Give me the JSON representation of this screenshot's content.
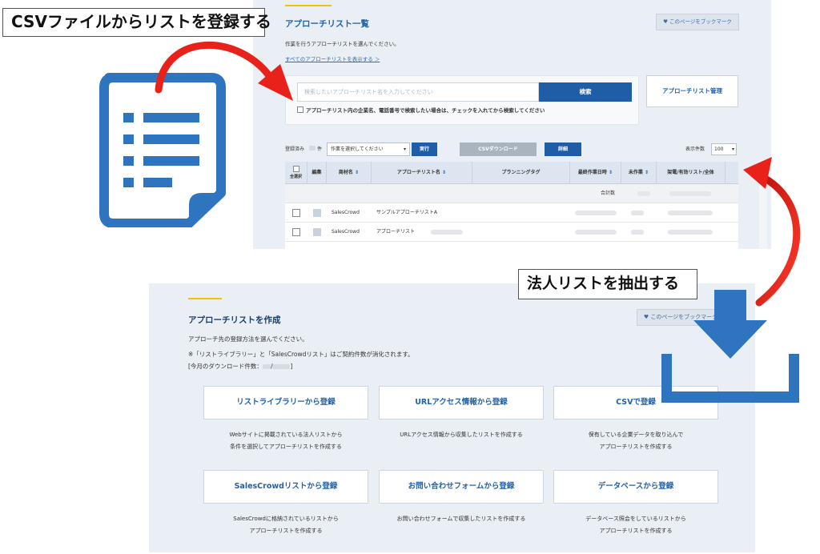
{
  "callouts": {
    "csv": "CSVファイルからリストを登録する",
    "extract": "法人リストを抽出する"
  },
  "list_page": {
    "title": "アプローチリスト一覧",
    "bookmark": "♥ このページをブックマーク",
    "subtitle": "作業を行うアプローチリストを選んでください。",
    "show_all_link": "すべてのアプローチリストを表示する ＞",
    "search_placeholder": "検索したいアプローチリスト名を入力してください",
    "search_button": "検索",
    "search_option": "アプローチリスト内の企業名、電話番号で検索したい場合は、チェックを入れてから検索してください",
    "manage_button": "アプローチリスト管理",
    "toolbar": {
      "registered_label": "登録済み",
      "count_unit": "件",
      "operation_select": "作業を選択してください",
      "exec_button": "実行",
      "csv_download": "CSVダウンロード",
      "detail_button": "詳細",
      "per_page_label": "表示件数",
      "per_page_value": "100"
    },
    "table": {
      "headers": {
        "select_all": "全選択",
        "edit": "編集",
        "company": "商材名",
        "list_name": "アプローチリスト名",
        "planning_tag": "プランニングタグ",
        "last_work_date": "最終作業日時",
        "unworked": "未作業",
        "valid_total": "架電/有効リスト/全体"
      },
      "total_label": "合計数",
      "rows": [
        {
          "company": "SalesCrowd",
          "list_name": "サンプルアプローチリストA"
        },
        {
          "company": "SalesCrowd",
          "list_name": "アプローチリスト"
        }
      ]
    }
  },
  "create_page": {
    "title": "アプローチリストを作成",
    "bookmark": "♥ このページをブックマーク",
    "lead": "アプローチ先の登録方法を選んでください。",
    "note": "※「リストライブラリー」と「SalesCrowdリスト」はご契約件数が消化されます。",
    "download_count_prefix": "[今月のダウンロード件数：",
    "download_count_sep": "/",
    "download_count_suffix": "]",
    "options": [
      {
        "label": "リストライブラリーから登録",
        "desc1": "Webサイトに掲載されている法人リストから",
        "desc2": "条件を選択してアプローチリストを作成する"
      },
      {
        "label": "URLアクセス情報から登録",
        "desc1": "URLアクセス情報から収集したリストを作成する",
        "desc2": ""
      },
      {
        "label": "CSVで登録",
        "desc1": "保有している企業データを取り込んで",
        "desc2": "アプローチリストを作成する"
      },
      {
        "label": "SalesCrowdリストから登録",
        "desc1": "SalesCrowdに格納されているリストから",
        "desc2": "アプローチリストを作成する"
      },
      {
        "label": "お問い合わせフォームから登録",
        "desc1": "お問い合わせフォームで収集したリストを作成する",
        "desc2": ""
      },
      {
        "label": "データベースから登録",
        "desc1": "データベース照会をしているリストから",
        "desc2": "アプローチリストを作成する"
      }
    ]
  },
  "icons": {
    "document": "document-list-icon",
    "download": "download-icon",
    "arrows": "red-curved-arrow"
  },
  "colors": {
    "brand_blue": "#1f5da6",
    "icon_blue": "#2e74be",
    "accent_yellow": "#f3c200",
    "arrow_red": "#e8221a",
    "panel_bg": "#e9eff5"
  }
}
